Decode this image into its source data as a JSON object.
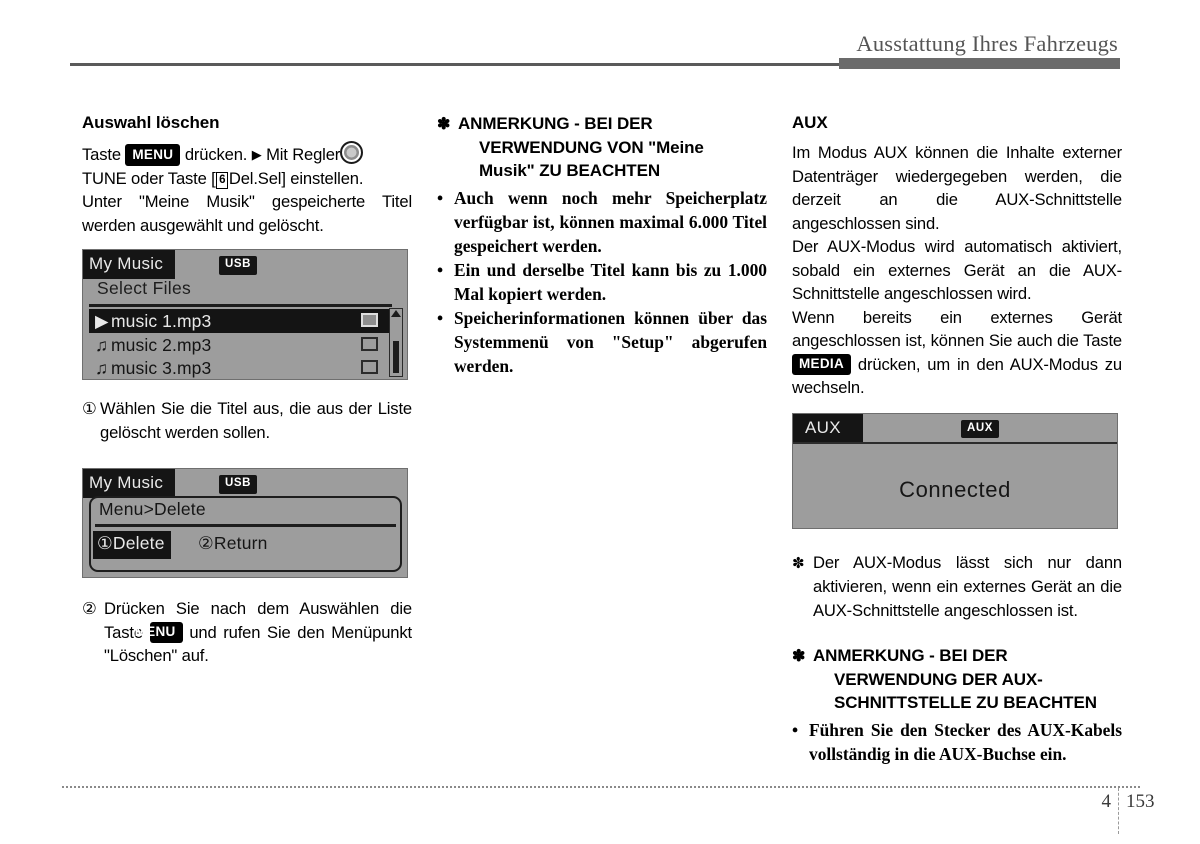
{
  "header": {
    "title": "Ausstattung Ihres Fahrzeugs"
  },
  "footer": {
    "chapter": "4",
    "page": "153"
  },
  "left_column": {
    "section_title": "Auswahl löschen",
    "intro": {
      "before_menu": "Taste",
      "menu_badge": "MENU",
      "after_menu": "drücken.",
      "arrow": "▶",
      "after_arrow": "Mit Regler",
      "knob_icon": "tune-knob-icon",
      "line2_before_box": "TUNE oder Taste [",
      "box_number": "6",
      "line2_after_box": "Del.Sel] einstellen.",
      "line3": "Unter \"Meine Musik\" gespeicherte Titel werden ausgewählt und gelöscht."
    },
    "lcd_select_files": {
      "tab": "My Music",
      "source_badge": "USB",
      "title": "Select Files",
      "rows": [
        {
          "icon": "▶",
          "label": "music 1.mp3",
          "selected": true,
          "checked": true
        },
        {
          "icon": "♫",
          "label": "music 2.mp3",
          "selected": false,
          "checked": false
        },
        {
          "icon": "♫",
          "label": "music 3.mp3",
          "selected": false,
          "checked": false
        }
      ]
    },
    "step1": {
      "num": "①",
      "text": "Wählen Sie die Titel aus, die aus der Liste gelöscht werden sollen."
    },
    "lcd_menu_delete": {
      "tab": "My Music",
      "source_badge": "USB",
      "title": "Menu>Delete",
      "option_delete": "①Delete",
      "option_return": "②Return"
    },
    "step2": {
      "num": "②",
      "text_before": "Drücken Sie nach dem Auswählen die Taste",
      "menu_badge": "MENU",
      "text_after": "und rufen Sie den Menüpunkt \"Löschen\" auf."
    }
  },
  "middle_column": {
    "note": {
      "star": "✽",
      "heading_line1": "ANMERKUNG - BEI DER",
      "heading_line2": "VERWENDUNG VON \"Meine",
      "heading_line3": "Musik\" ZU BEACHTEN",
      "bullet_char": "•",
      "bullets": [
        "Auch wenn noch mehr Speicherplatz verfügbar ist, können maximal 6.000 Titel gespeichert werden.",
        "Ein und derselbe Titel kann bis zu 1.000 Mal kopiert werden.",
        "Speicherinformationen können über das Systemmenü von \"Setup\" abgerufen werden."
      ]
    }
  },
  "right_column": {
    "section_title": "AUX",
    "paragraph1": "Im Modus AUX können die Inhalte externer Datenträger wiedergegeben werden, die derzeit an die AUX-Schnittstelle angeschlossen sind.",
    "paragraph2": "Der AUX-Modus wird automatisch aktiviert, sobald ein externes Gerät an die AUX-Schnittstelle angeschlossen wird.",
    "paragraph3_before": "Wenn bereits ein externes Gerät angeschlossen ist, können Sie auch die Taste",
    "paragraph3_badge": "MEDIA",
    "paragraph3_after": "drücken, um in den AUX-Modus zu wechseln.",
    "lcd_aux": {
      "tab": "AUX",
      "mode_badge": "AUX",
      "status": "Connected"
    },
    "star_note": {
      "star": "✽",
      "text": "Der AUX-Modus lässt sich nur dann aktivieren, wenn ein externes Gerät an die AUX-Schnittstelle angeschlossen ist."
    },
    "note": {
      "star": "✽",
      "heading_line1": "ANMERKUNG - BEI DER",
      "heading_line2": "VERWENDUNG DER AUX-",
      "heading_line3": "SCHNITTSTELLE ZU BEACHTEN",
      "bullet_char": "•",
      "bullets": [
        "Führen Sie den Stecker des AUX-Kabels vollständig in die AUX-Buchse ein."
      ]
    }
  }
}
